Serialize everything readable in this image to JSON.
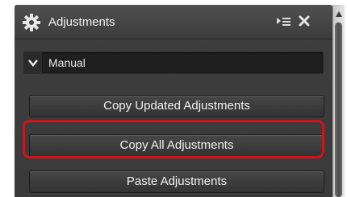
{
  "header": {
    "title": "Adjustments",
    "icons": [
      "gear-icon",
      "panel-menu-icon",
      "close-icon"
    ]
  },
  "preset": {
    "value": "Manual"
  },
  "buttons": {
    "copy_updated": "Copy Updated Adjustments",
    "copy_all": "Copy All Adjustments",
    "paste": "Paste Adjustments"
  },
  "highlight": {
    "color": "#d0141b",
    "target": "Copy All Adjustments"
  },
  "colors": {
    "panel_bg": "#3a3a3a",
    "text": "#f2f2f2"
  }
}
